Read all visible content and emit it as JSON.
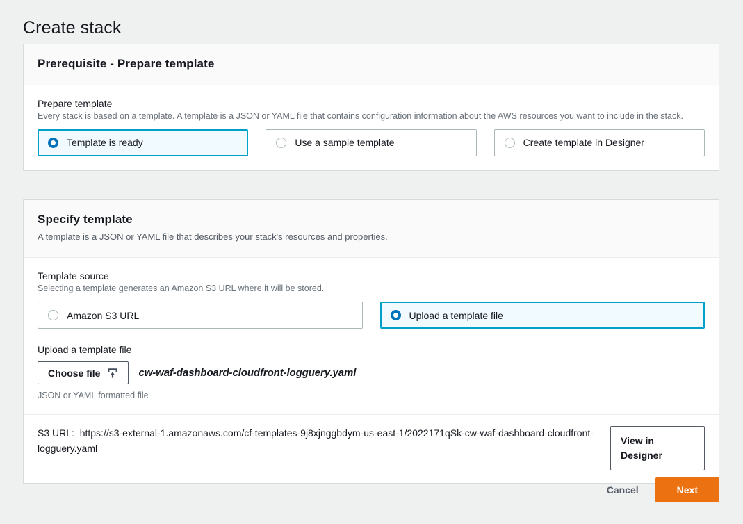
{
  "page": {
    "title": "Create stack"
  },
  "prerequisite": {
    "heading": "Prerequisite - Prepare template",
    "field_label": "Prepare template",
    "field_desc": "Every stack is based on a template. A template is a JSON or YAML file that contains configuration information about the AWS resources you want to include in the stack.",
    "options": [
      {
        "label": "Template is ready",
        "selected": true
      },
      {
        "label": "Use a sample template",
        "selected": false
      },
      {
        "label": "Create template in Designer",
        "selected": false
      }
    ]
  },
  "specify": {
    "heading": "Specify template",
    "subheading": "A template is a JSON or YAML file that describes your stack's resources and properties.",
    "source_label": "Template source",
    "source_desc": "Selecting a template generates an Amazon S3 URL where it will be stored.",
    "source_options": [
      {
        "label": "Amazon S3 URL",
        "selected": false
      },
      {
        "label": "Upload a template file",
        "selected": true
      }
    ],
    "upload_label": "Upload a template file",
    "choose_file_button": "Choose file",
    "upload_icon": "upload-icon",
    "file_name": "cw-waf-dashboard-cloudfront-logguery.yaml",
    "file_hint": "JSON or YAML formatted file",
    "s3_url_label": "S3 URL:",
    "s3_url_value": "https://s3-external-1.amazonaws.com/cf-templates-9j8xjnggbdym-us-east-1/2022171qSk-cw-waf-dashboard-cloudfront-logguery.yaml",
    "view_in_designer_button": "View in Designer"
  },
  "footer": {
    "cancel_label": "Cancel",
    "next_label": "Next"
  },
  "colors": {
    "page_background": "#eff0f0",
    "card_header_background": "#fafafa",
    "card_border": "#d5dbdb",
    "selected_radio_border": "#00a1c9",
    "selected_radio_fill": "#f1faff",
    "radio_dot": "#0073bb",
    "primary_button": "#ec7211",
    "secondary_text": "#687078"
  }
}
